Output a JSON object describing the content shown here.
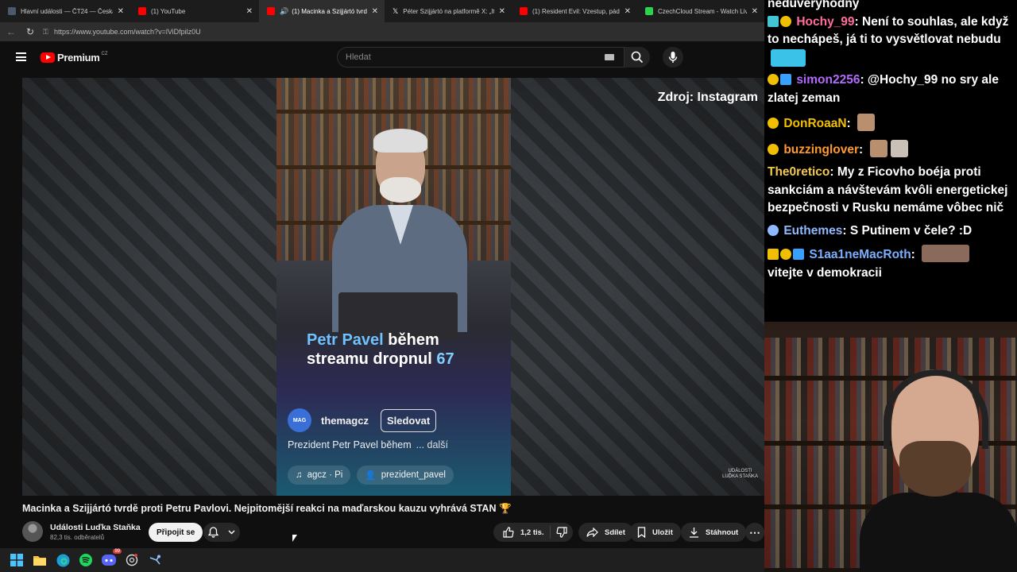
{
  "browser": {
    "tabs": [
      {
        "title": "Hlavní události — ČT24 — Česká ...",
        "favicon_color": "#4a5a6a",
        "active": false
      },
      {
        "title": "(1) YouTube",
        "favicon_color": "#ff0000",
        "active": false
      },
      {
        "title": "(1) Macinka a Szijjártó tvrdě p...",
        "favicon_color": "#ff0000",
        "active": true
      },
      {
        "title": "Péter Szijjártó na platformě X: „It h...",
        "favicon_color": "#ffffff",
        "active": false
      },
      {
        "title": "(1) Resident Evil: Vzestup, pád a zn...",
        "favicon_color": "#ff0000",
        "active": false
      },
      {
        "title": "CzechCloud Stream - Watch Live o...",
        "favicon_color": "#2bd34b",
        "active": false
      }
    ],
    "url": "https://www.youtube.com/watch?v=lViDfpilz0U"
  },
  "youtube": {
    "logo_text": "Premium",
    "logo_region": "CZ",
    "search_placeholder": "Hledat",
    "video": {
      "source_label": "Zdroj: Instagram",
      "watermark_top": "UDÁLOSTI",
      "watermark_bottom": "LUĎKA STAŇKA",
      "reel": {
        "caption_highlight": "Petr Pavel",
        "caption_rest_1": "během",
        "caption_line2": "streamu dropnul",
        "caption_number": "67",
        "avatar_text": "MAG",
        "username": "themagcz",
        "follow_label": "Sledovat",
        "description": "Prezident Petr Pavel během",
        "more_label": "... další",
        "music_tag": "agcz · Pi",
        "person_tag": "prezident_pavel"
      }
    },
    "title": "Macinka a Szijjártó tvrdě proti Petru Pavlovi. Nejpitomější reakci na maďarskou kauzu vyhrává STAN 🏆",
    "channel": {
      "name": "Události Luďka Staňka",
      "subscribers": "82,3 tis. odběratelů",
      "join_label": "Připojit se"
    },
    "actions": {
      "likes": "1,2 tis.",
      "share_label": "Sdílet",
      "save_label": "Uložit",
      "download_label": "Stáhnout"
    }
  },
  "chat": {
    "messages": [
      {
        "user": "",
        "user_color": "#ffffff",
        "text": "nedůvěryhodný"
      },
      {
        "user": "Hochy_99",
        "user_color": "#ff6e9a",
        "text": "Není to souhlas, ale když to nechápeš, já ti to vysvětlovat nebudu"
      },
      {
        "user": "simon2256",
        "user_color": "#b36bff",
        "text": "@Hochy_99 no sry ale zlatej zeman"
      },
      {
        "user": "DonRoaaN",
        "user_color": "#f0c000",
        "text": ""
      },
      {
        "user": "buzzinglover",
        "user_color": "#ff9a2e",
        "text": ""
      },
      {
        "user": "The0retico",
        "user_color": "#f2c94c",
        "text": "My z Ficovho boéja proti sankciám a návštevám kvôli energetickej bezpečnosti v Rusku nemáme vôbec nič"
      },
      {
        "user": "Euthemes",
        "user_color": "#8fb8ff",
        "text": "S Putinem v čele? :D"
      },
      {
        "user": "S1aa1neMacRoth",
        "user_color": "#7ab0ff",
        "text": "vitejte v demokracii"
      }
    ]
  },
  "taskbar": {
    "icons": [
      "windows-icon",
      "file-explorer-icon",
      "edge-icon",
      "spotify-icon",
      "discord-icon",
      "chatgpt-icon",
      "steam-icon"
    ],
    "discord_badge": "99"
  }
}
